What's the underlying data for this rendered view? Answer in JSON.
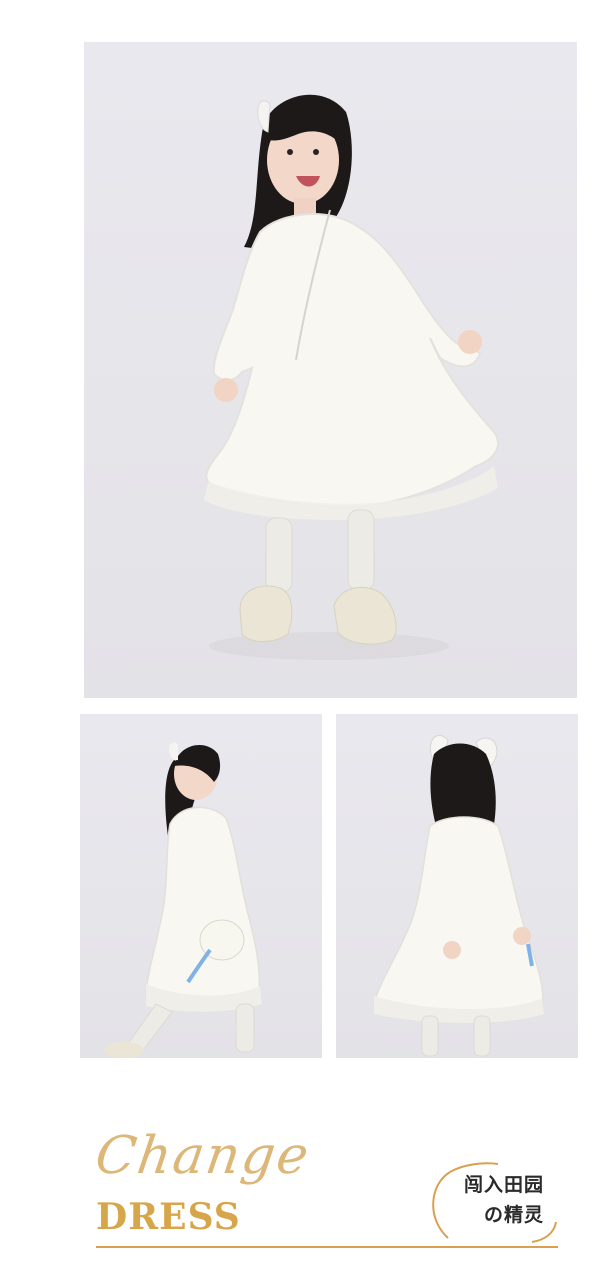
{
  "photos": {
    "hero": {
      "alt": ""
    },
    "side": {
      "alt": ""
    },
    "back": {
      "alt": ""
    }
  },
  "footer": {
    "script_text": "Change",
    "title": "DRESS",
    "cn_line1": "闯入田园",
    "cn_line2": "の精灵"
  },
  "colors": {
    "gold": "#d8a64a",
    "photo_bg": "#e8e7ec",
    "dress": "#f8f7f3",
    "hair": "#1a1716"
  }
}
